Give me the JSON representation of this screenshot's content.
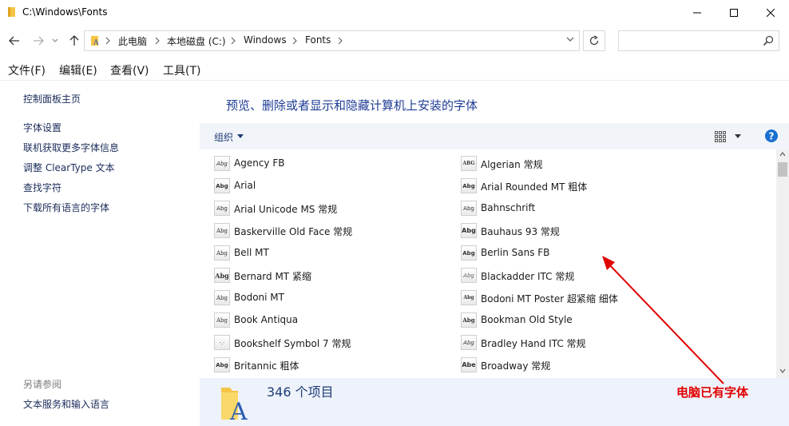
{
  "window": {
    "title": "C:\\Windows\\Fonts"
  },
  "address": {
    "crumbs": [
      "此电脑",
      "本地磁盘 (C:)",
      "Windows",
      "Fonts"
    ]
  },
  "search": {
    "placeholder": ""
  },
  "menu": {
    "items": [
      "文件(F)",
      "编辑(E)",
      "查看(V)",
      "工具(T)"
    ]
  },
  "sidebar": {
    "home": "控制面板主页",
    "links": [
      "字体设置",
      "联机获取更多字体信息",
      "调整 ClearType 文本",
      "查找字符",
      "下载所有语言的字体"
    ],
    "see_also_heading": "另请参阅",
    "see_also_links": [
      "文本服务和输入语言"
    ]
  },
  "main": {
    "heading": "预览、删除或者显示和隐藏计算机上安装的字体",
    "organize_label": "组织"
  },
  "fonts": {
    "left": [
      {
        "name": "Agency FB",
        "thumb": "Abg"
      },
      {
        "name": "Arial",
        "thumb": "Abg"
      },
      {
        "name": "Arial Unicode MS 常规",
        "thumb": "Abg"
      },
      {
        "name": "Baskerville Old Face 常规",
        "thumb": "Abg"
      },
      {
        "name": "Bell MT",
        "thumb": "Abg"
      },
      {
        "name": "Bernard MT 紧缩",
        "thumb": "Abg"
      },
      {
        "name": "Bodoni MT",
        "thumb": "Abg"
      },
      {
        "name": "Book Antiqua",
        "thumb": "Abg"
      },
      {
        "name": "Bookshelf Symbol 7 常规",
        "thumb": "·.·"
      },
      {
        "name": "Britannic 粗体",
        "thumb": "Abg"
      }
    ],
    "right": [
      {
        "name": "Algerian 常规",
        "thumb": "ABG"
      },
      {
        "name": "Arial Rounded MT 粗体",
        "thumb": "Abg"
      },
      {
        "name": "Bahnschrift",
        "thumb": "Abg"
      },
      {
        "name": "Bauhaus 93 常规",
        "thumb": "Abg"
      },
      {
        "name": "Berlin Sans FB",
        "thumb": "Abg"
      },
      {
        "name": "Blackadder ITC 常规",
        "thumb": "Abg"
      },
      {
        "name": "Bodoni MT Poster 超紧缩 细体",
        "thumb": "Abg"
      },
      {
        "name": "Bookman Old Style",
        "thumb": "Abg"
      },
      {
        "name": "Bradley Hand ITC 常规",
        "thumb": "Abg"
      },
      {
        "name": "Broadway 常规",
        "thumb": "Abe"
      }
    ]
  },
  "status": {
    "count_text": "346 个项目"
  },
  "annotation": {
    "text": "电脑已有字体",
    "color": "#e00000"
  },
  "colors": {
    "accent": "#1e3c96",
    "help_blue": "#1a6fd1"
  }
}
